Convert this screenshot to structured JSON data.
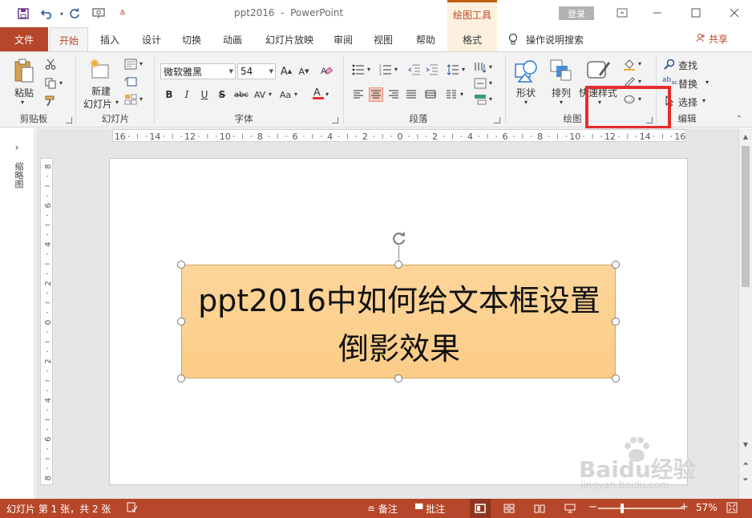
{
  "title_bar": {
    "doc_name": "ppt2016",
    "separator": "-",
    "app_name": "PowerPoint",
    "tool_tab_title": "绘图工具",
    "login_label": "登录"
  },
  "tabs": {
    "file": "文件",
    "items": [
      "开始",
      "插入",
      "设计",
      "切换",
      "动画",
      "幻灯片放映",
      "审阅",
      "视图",
      "帮助",
      "格式"
    ],
    "active": "开始",
    "search_placeholder": "操作说明搜索",
    "share": "共享"
  },
  "ribbon": {
    "clipboard": {
      "paste": "粘贴",
      "label": "剪贴板"
    },
    "slides": {
      "new_slide_line1": "新建",
      "new_slide_line2": "幻灯片",
      "label": "幻灯片"
    },
    "font": {
      "font_name": "微软雅黑",
      "font_size": "54",
      "label": "字体"
    },
    "paragraph": {
      "label": "段落"
    },
    "drawing": {
      "shapes": "形状",
      "arrange": "排列",
      "quick_styles": "快速样式",
      "label": "绘图"
    },
    "editing": {
      "find": "查找",
      "replace": "替换",
      "select": "选择",
      "label": "编辑"
    }
  },
  "left_panel": {
    "label": "缩略图"
  },
  "hruler": {
    "labels": [
      "16",
      "14",
      "12",
      "10",
      "8",
      "6",
      "4",
      "2",
      "0",
      "2",
      "4",
      "6",
      "8",
      "10",
      "12",
      "14",
      "16"
    ]
  },
  "vruler": {
    "labels": [
      "8",
      "6",
      "4",
      "2",
      "0",
      "2",
      "4",
      "6",
      "8"
    ]
  },
  "slide": {
    "textbox_line1": "ppt2016中如何给文本框设置",
    "textbox_line2": "倒影效果"
  },
  "status": {
    "slide_info": "幻灯片 第 1 张，共 2 张",
    "notes": "备注",
    "comments": "批注",
    "zoom": "57%",
    "zoom_fraction": 0.28
  },
  "watermark": {
    "brand": "Baidu经验",
    "url": "jingyan.baidu.com"
  },
  "colors": {
    "accent": "#b7472a",
    "highlight": "#e52d2d",
    "textbox_fill": "#fdd59a"
  }
}
